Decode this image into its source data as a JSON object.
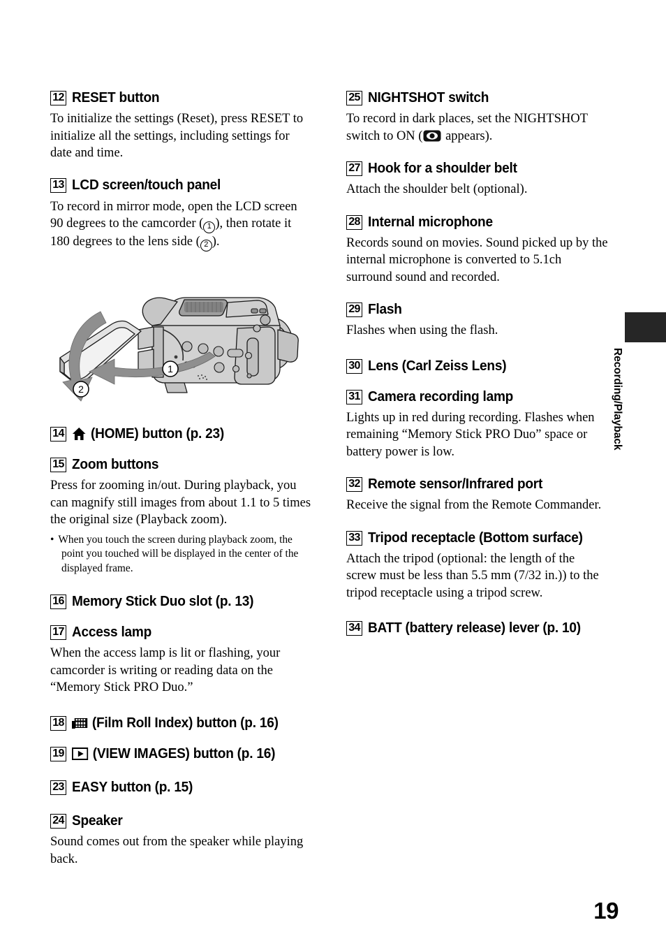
{
  "page": {
    "number": "19",
    "side_tab_label": "Recording/Playback"
  },
  "left_column": {
    "entries": [
      {
        "num": "12",
        "title": "RESET button",
        "body": "To initialize the settings (Reset), press RESET to initialize all the settings, including settings for date and time."
      },
      {
        "num": "13",
        "title": "LCD screen/touch panel",
        "body_1": "To record in mirror mode, open the LCD screen 90 degrees to the camcorder (",
        "circle_1": "1",
        "body_2": "), then rotate it 180 degrees to the lens side (",
        "circle_2": "2",
        "body_3": ")."
      },
      {
        "num": "14",
        "icon": "home-icon",
        "title": "(HOME) button (p. 23)"
      },
      {
        "num": "15",
        "title": "Zoom buttons",
        "body": "Press for zooming in/out. During playback, you can magnify still images from about 1.1 to 5 times the original size (Playback zoom).",
        "note_bullet": "•",
        "note": "When you touch the screen during playback zoom, the point you touched will be displayed in the center of the displayed frame."
      },
      {
        "num": "16",
        "title": "Memory Stick Duo slot (p. 13)"
      },
      {
        "num": "17",
        "title": "Access lamp",
        "body": "When the access lamp is lit or flashing, your camcorder is writing or reading data on the “Memory Stick PRO Duo.”"
      },
      {
        "num": "18",
        "icon": "film-roll-index-icon",
        "title": "(Film Roll Index) button (p. 16)"
      },
      {
        "num": "19",
        "icon": "view-images-icon",
        "title": "(VIEW IMAGES) button (p. 16)"
      },
      {
        "num": "23",
        "title": "EASY button (p. 15)"
      },
      {
        "num": "24",
        "title": "Speaker",
        "body": "Sound comes out from the speaker while playing back."
      }
    ],
    "figure": {
      "name": "lcd-rotation-illustration",
      "callout_1": "1",
      "callout_2": "2"
    }
  },
  "right_column": {
    "entries": [
      {
        "num": "25",
        "title": "NIGHTSHOT switch",
        "body_1": "To record in dark places, set the NIGHTSHOT switch to ON (",
        "inline_icon": "nightshot-icon",
        "body_2": " appears)."
      },
      {
        "num": "27",
        "title": "Hook for a shoulder belt",
        "body": "Attach the shoulder belt (optional)."
      },
      {
        "num": "28",
        "title": "Internal microphone",
        "body": "Records sound on movies. Sound picked up by the internal microphone is converted to 5.1ch surround sound and recorded."
      },
      {
        "num": "29",
        "title": "Flash",
        "body": "Flashes when using the flash."
      },
      {
        "num": "30",
        "title": "Lens (Carl Zeiss Lens)"
      },
      {
        "num": "31",
        "title": "Camera recording lamp",
        "body": "Lights up in red during recording. Flashes when remaining “Memory Stick PRO Duo” space or battery power is low."
      },
      {
        "num": "32",
        "title": "Remote sensor/Infrared port",
        "body": "Receive the signal from the Remote Commander."
      },
      {
        "num": "33",
        "title": "Tripod receptacle (Bottom surface)",
        "body": "Attach the tripod (optional: the length of the screw must be less than 5.5 mm (7/32 in.)) to the tripod receptacle using a tripod screw."
      },
      {
        "num": "34",
        "title": "BATT (battery release) lever (p. 10)"
      }
    ]
  },
  "colors": {
    "text": "#000000",
    "tab_background": "#262626",
    "illustration_fill": "#d2d2d2",
    "illustration_arrow": "#8c8c8c"
  }
}
